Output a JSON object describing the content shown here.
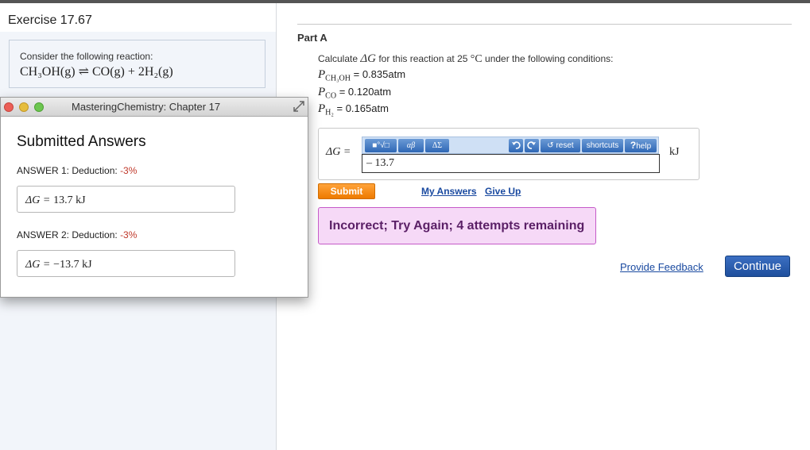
{
  "left": {
    "exercise_title": "Exercise 17.67",
    "reaction_prompt": "Consider the following reaction:",
    "reaction_equation": "CH₃OH(g) ⇌ CO(g) + 2H₂(g)"
  },
  "popup": {
    "window_title": "MasteringChemistry: Chapter 17",
    "heading": "Submitted Answers",
    "answers": [
      {
        "label": "ANSWER 1: Deduction: ",
        "deduction": "-3%",
        "lhs": "ΔG =",
        "value": "13.7  kJ"
      },
      {
        "label": "ANSWER 2: Deduction: ",
        "deduction": "-3%",
        "lhs": "ΔG =",
        "value": "−13.7  kJ"
      }
    ]
  },
  "part": {
    "label": "Part A",
    "question_pre": "Calculate ",
    "question_symbol": "ΔG",
    "question_mid": " for this reaction at 25 ",
    "question_unit": "°C",
    "question_post": " under the following conditions:",
    "conditions": [
      {
        "symbol": "P",
        "sub": "CH₃OH",
        "value": " = 0.835atm"
      },
      {
        "symbol": "P",
        "sub": "CO",
        "value": " = 0.120atm"
      },
      {
        "symbol": "P",
        "sub": "H₂",
        "value": " = 0.165atm"
      }
    ]
  },
  "editor": {
    "lhs": "ΔG =",
    "toolbar": {
      "templates": "■°√□",
      "greek": "αβ",
      "symbols": "ΔΣ",
      "reset": "reset",
      "shortcuts": "shortcuts",
      "help": "help"
    },
    "input_value": "– 13.7",
    "unit": "kJ"
  },
  "actions": {
    "submit": "Submit",
    "my_answers": "My Answers",
    "give_up": "Give Up",
    "feedback_message": "Incorrect; Try Again; 4 attempts remaining",
    "provide_feedback": "Provide Feedback",
    "continue": "Continue"
  },
  "colors": {
    "submit": "#ee7a00",
    "continue": "#1f4f9d",
    "feedback_bg": "#f6d9f7",
    "deduction": "#c0392b"
  }
}
